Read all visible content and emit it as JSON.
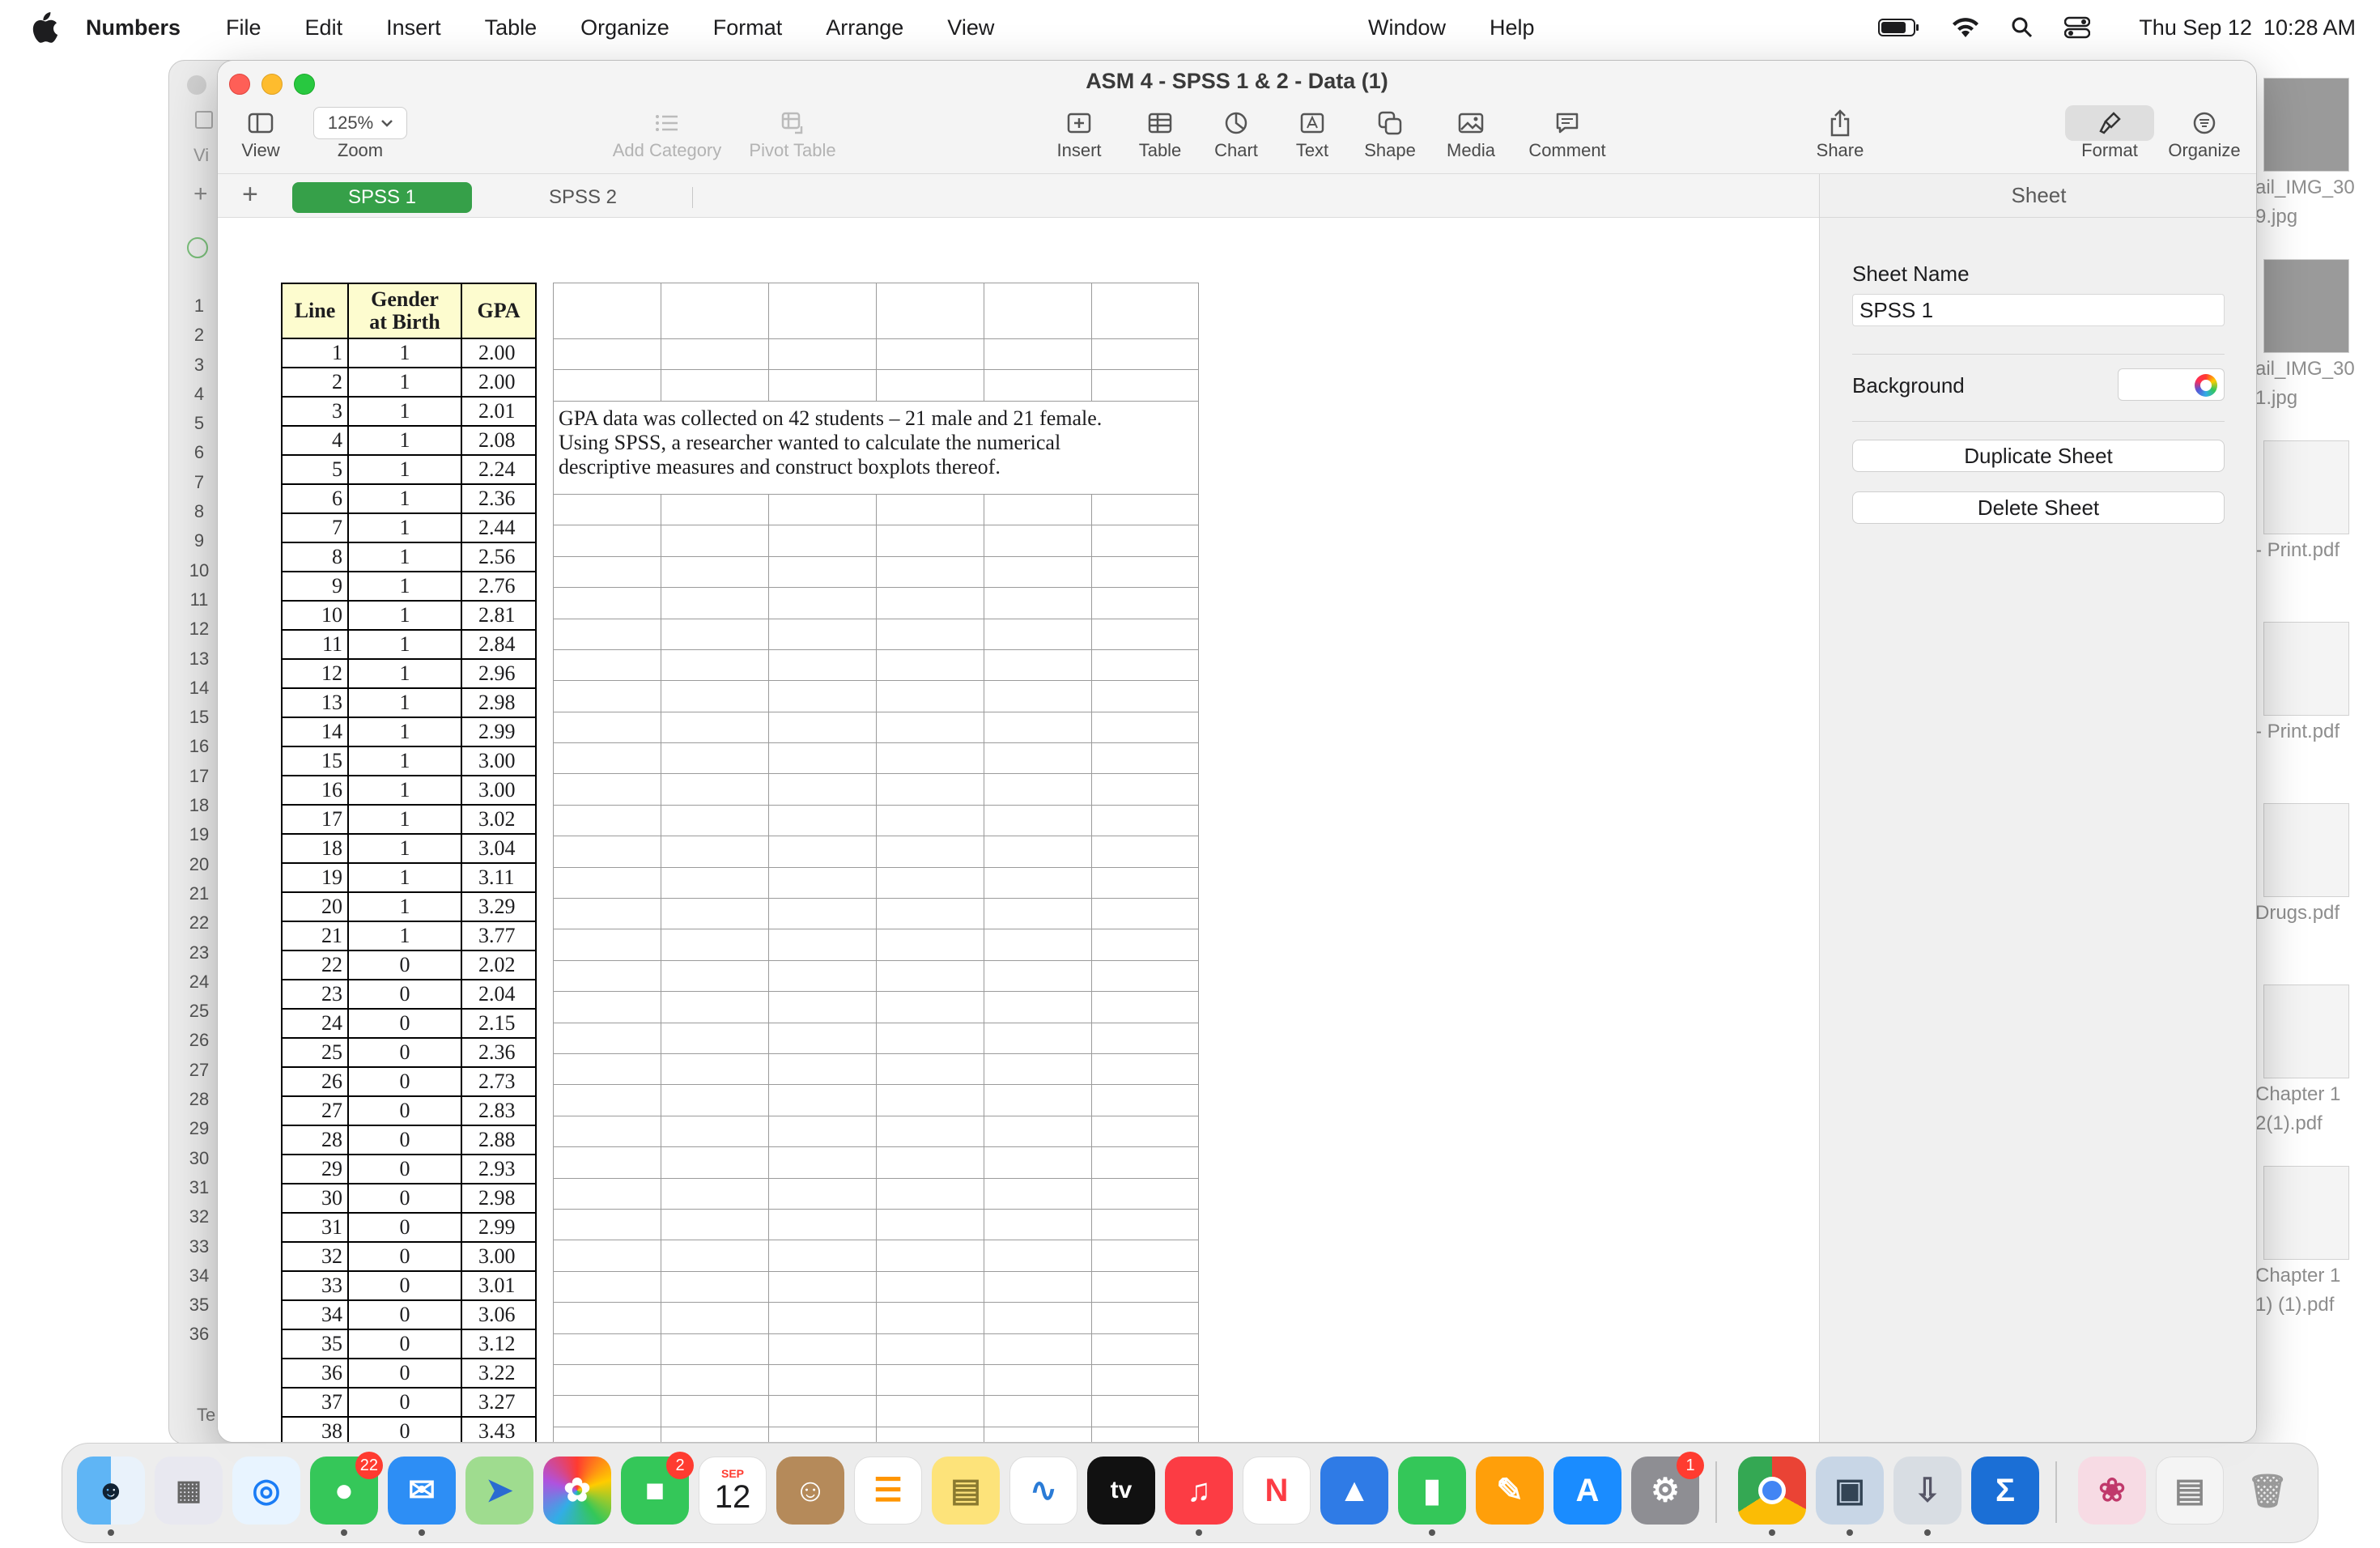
{
  "menubar": {
    "app_name": "Numbers",
    "menus_left": [
      "File",
      "Edit",
      "Insert",
      "Table",
      "Organize",
      "Format",
      "Arrange",
      "View"
    ],
    "menus_mid": [
      "Window",
      "Help"
    ],
    "date": "Thu Sep 12",
    "time": "10:28 AM"
  },
  "window": {
    "title": "ASM 4 - SPSS 1 & 2 - Data (1)",
    "toolbar": {
      "view": "View",
      "zoom_value": "125%",
      "zoom": "Zoom",
      "add_category": "Add Category",
      "pivot_table": "Pivot Table",
      "insert": "Insert",
      "table": "Table",
      "chart": "Chart",
      "text": "Text",
      "shape": "Shape",
      "media": "Media",
      "comment": "Comment",
      "share": "Share",
      "format": "Format",
      "organize": "Organize"
    },
    "tabs": [
      {
        "label": "SPSS 1",
        "active": true
      },
      {
        "label": "SPSS 2",
        "active": false
      }
    ]
  },
  "table": {
    "headers": {
      "line": "Line",
      "gender_1": "Gender",
      "gender_2": "at Birth",
      "gpa": "GPA"
    },
    "rows": [
      [
        "1",
        "1",
        "2.00"
      ],
      [
        "2",
        "1",
        "2.00"
      ],
      [
        "3",
        "1",
        "2.01"
      ],
      [
        "4",
        "1",
        "2.08"
      ],
      [
        "5",
        "1",
        "2.24"
      ],
      [
        "6",
        "1",
        "2.36"
      ],
      [
        "7",
        "1",
        "2.44"
      ],
      [
        "8",
        "1",
        "2.56"
      ],
      [
        "9",
        "1",
        "2.76"
      ],
      [
        "10",
        "1",
        "2.81"
      ],
      [
        "11",
        "1",
        "2.84"
      ],
      [
        "12",
        "1",
        "2.96"
      ],
      [
        "13",
        "1",
        "2.98"
      ],
      [
        "14",
        "1",
        "2.99"
      ],
      [
        "15",
        "1",
        "3.00"
      ],
      [
        "16",
        "1",
        "3.00"
      ],
      [
        "17",
        "1",
        "3.02"
      ],
      [
        "18",
        "1",
        "3.04"
      ],
      [
        "19",
        "1",
        "3.11"
      ],
      [
        "20",
        "1",
        "3.29"
      ],
      [
        "21",
        "1",
        "3.77"
      ],
      [
        "22",
        "0",
        "2.02"
      ],
      [
        "23",
        "0",
        "2.04"
      ],
      [
        "24",
        "0",
        "2.15"
      ],
      [
        "25",
        "0",
        "2.36"
      ],
      [
        "26",
        "0",
        "2.73"
      ],
      [
        "27",
        "0",
        "2.83"
      ],
      [
        "28",
        "0",
        "2.88"
      ],
      [
        "29",
        "0",
        "2.93"
      ],
      [
        "30",
        "0",
        "2.98"
      ],
      [
        "31",
        "0",
        "2.99"
      ],
      [
        "32",
        "0",
        "3.00"
      ],
      [
        "33",
        "0",
        "3.01"
      ],
      [
        "34",
        "0",
        "3.06"
      ],
      [
        "35",
        "0",
        "3.12"
      ],
      [
        "36",
        "0",
        "3.22"
      ],
      [
        "37",
        "0",
        "3.27"
      ],
      [
        "38",
        "0",
        "3.43"
      ]
    ]
  },
  "note": {
    "line1": "GPA data was collected on 42 students – 21 male and 21 female.",
    "line2": "Using SPSS, a researcher wanted to calculate the numerical",
    "line3": "descriptive measures and construct boxplots thereof."
  },
  "inspector": {
    "header": "Sheet",
    "sheet_name_label": "Sheet Name",
    "sheet_name_value": "SPSS 1",
    "background_label": "Background",
    "duplicate": "Duplicate Sheet",
    "delete": "Delete Sheet"
  },
  "background_window": {
    "row_numbers": [
      "1",
      "2",
      "3",
      "4",
      "5",
      "6",
      "7",
      "8",
      "9",
      "10",
      "11",
      "12",
      "13",
      "14",
      "15",
      "16",
      "17",
      "18",
      "19",
      "20",
      "21",
      "22",
      "23",
      "24",
      "25",
      "26",
      "27",
      "28",
      "29",
      "30",
      "31",
      "32",
      "33",
      "34",
      "35",
      "36"
    ],
    "partial_label_vi": "Vi",
    "partial_label_te": "Te"
  },
  "desktop_files": [
    {
      "label": "ail_IMG_30",
      "label2": "9.jpg"
    },
    {
      "label": "ail_IMG_30",
      "label2": "1.jpg"
    },
    {
      "label": "- Print.pdf",
      "label2": ""
    },
    {
      "label": "- Print.pdf",
      "label2": ""
    },
    {
      "label": "Drugs.pdf",
      "label2": ""
    },
    {
      "label": "Chapter 1",
      "label2": "2(1).pdf"
    },
    {
      "label": "Chapter 1",
      "label2": "1) (1).pdf"
    }
  ],
  "dock": {
    "messages_badge": "22",
    "facetime_badge": "2",
    "calendar_month": "SEP",
    "calendar_day": "12",
    "settings_badge": "1",
    "tv_label": "tv"
  },
  "colors": {
    "tab_active": "#36a049",
    "header_fill": "#fdfccf",
    "close": "#fe5f57",
    "minimize": "#febc2e",
    "maximize": "#28c840"
  }
}
